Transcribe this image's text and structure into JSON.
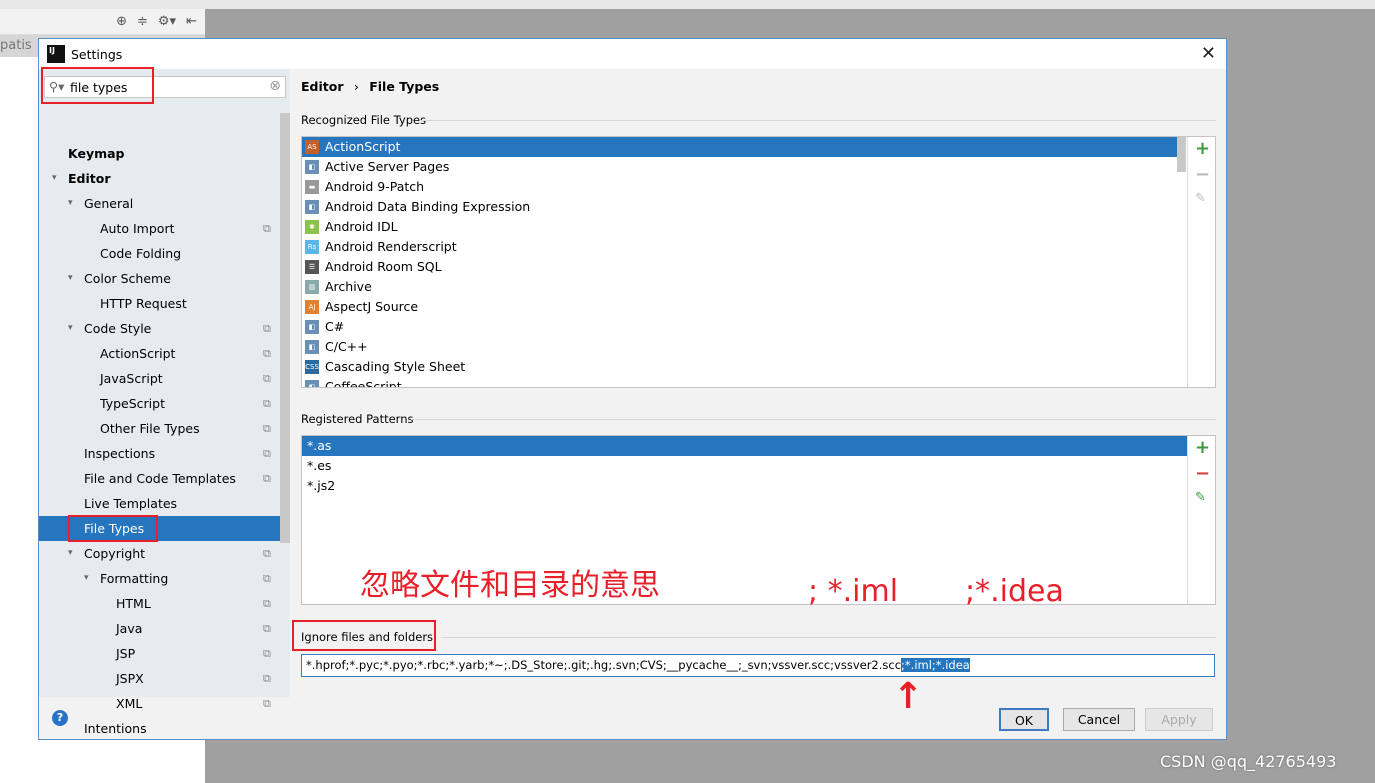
{
  "background": {
    "tab_label": "patis",
    "toolbar_icons": [
      "crosshair-icon",
      "collapse-icon",
      "gear-icon",
      "hide-icon"
    ]
  },
  "dialog": {
    "title": "Settings",
    "search_value": "file types",
    "tree": [
      {
        "label": "Keymap",
        "level": 0,
        "bold": true
      },
      {
        "label": "Editor",
        "level": 0,
        "bold": true,
        "expanded": true
      },
      {
        "label": "General",
        "level": 1,
        "expanded": true
      },
      {
        "label": "Auto Import",
        "level": 2,
        "copy": true
      },
      {
        "label": "Code Folding",
        "level": 2
      },
      {
        "label": "Color Scheme",
        "level": 1,
        "expanded": true
      },
      {
        "label": "HTTP Request",
        "level": 2
      },
      {
        "label": "Code Style",
        "level": 1,
        "expanded": true,
        "copy": true
      },
      {
        "label": "ActionScript",
        "level": 2,
        "copy": true
      },
      {
        "label": "JavaScript",
        "level": 2,
        "copy": true
      },
      {
        "label": "TypeScript",
        "level": 2,
        "copy": true
      },
      {
        "label": "Other File Types",
        "level": 2,
        "copy": true
      },
      {
        "label": "Inspections",
        "level": 1,
        "copy": true
      },
      {
        "label": "File and Code Templates",
        "level": 1,
        "copy": true
      },
      {
        "label": "Live Templates",
        "level": 1
      },
      {
        "label": "File Types",
        "level": 1,
        "selected": true
      },
      {
        "label": "Copyright",
        "level": 1,
        "expanded": true,
        "copy": true
      },
      {
        "label": "Formatting",
        "level": 2,
        "expanded": true,
        "copy": true
      },
      {
        "label": "HTML",
        "level": 3,
        "copy": true
      },
      {
        "label": "Java",
        "level": 3,
        "copy": true
      },
      {
        "label": "JSP",
        "level": 3,
        "copy": true
      },
      {
        "label": "JSPX",
        "level": 3,
        "copy": true
      },
      {
        "label": "XML",
        "level": 3,
        "copy": true
      },
      {
        "label": "Intentions",
        "level": 1
      }
    ],
    "breadcrumb": {
      "parent": "Editor",
      "sep": "›",
      "current": "File Types"
    },
    "recognized_label": "Recognized File Types",
    "file_types": [
      {
        "label": "ActionScript",
        "icon": "AS",
        "color": "#c0602a"
      },
      {
        "label": "Active Server Pages",
        "icon": "◧",
        "color": "#6a8fb5"
      },
      {
        "label": "Android 9-Patch",
        "icon": "▬",
        "color": "#999"
      },
      {
        "label": "Android Data Binding Expression",
        "icon": "◧",
        "color": "#6a8fb5"
      },
      {
        "label": "Android IDL",
        "icon": "✱",
        "color": "#8bc34a"
      },
      {
        "label": "Android Renderscript",
        "icon": "Rs",
        "color": "#5bb5e6"
      },
      {
        "label": "Android Room SQL",
        "icon": "☰",
        "color": "#555"
      },
      {
        "label": "Archive",
        "icon": "▥",
        "color": "#8aa"
      },
      {
        "label": "AspectJ Source",
        "icon": "AJ",
        "color": "#e08030"
      },
      {
        "label": "C#",
        "icon": "◧",
        "color": "#6a8fb5"
      },
      {
        "label": "C/C++",
        "icon": "◧",
        "color": "#6a8fb5"
      },
      {
        "label": "Cascading Style Sheet",
        "icon": "CSS",
        "color": "#2a6aa0"
      },
      {
        "label": "CoffeeScript",
        "icon": "◧",
        "color": "#6a8fb5"
      }
    ],
    "patterns_label": "Registered Patterns",
    "patterns": [
      "*.as",
      "*.es",
      "*.js2"
    ],
    "ignore_label": "Ignore files and folders",
    "ignore_value_prefix": "*.hprof;*.pyc;*.pyo;*.rbc;*.yarb;*~;.DS_Store;.git;.hg;.svn;CVS;__pycache__;_svn;vssver.scc;vssver2.scc",
    "ignore_value_selected": ";*.iml;*.idea",
    "buttons": {
      "ok": "OK",
      "cancel": "Cancel",
      "apply": "Apply"
    },
    "help": "?"
  },
  "annotations": {
    "chinese": "忽略文件和目录的意思",
    "iml": ";  *.iml",
    "idea": ";*.idea",
    "arrow": "↑"
  },
  "watermark": "CSDN @qq_42765493"
}
